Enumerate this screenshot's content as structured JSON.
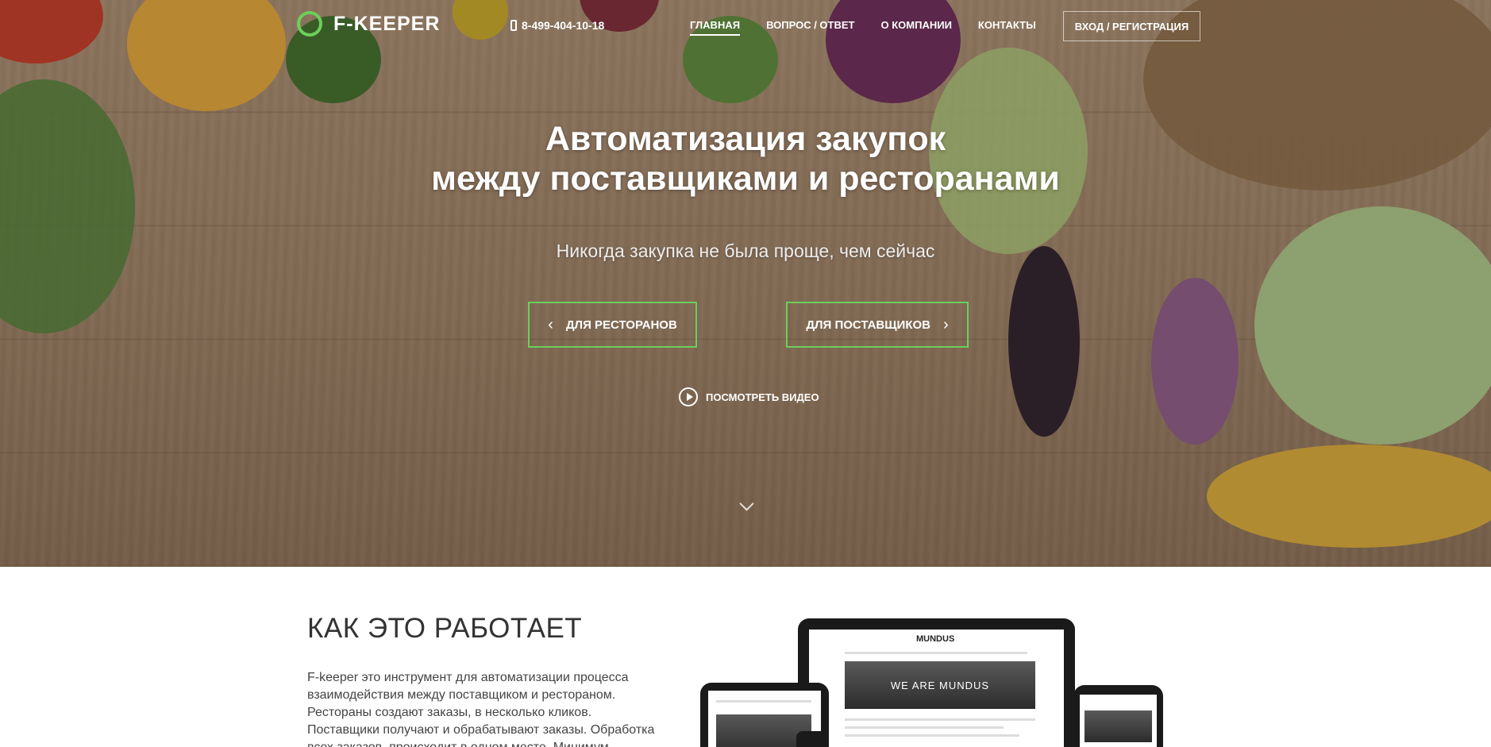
{
  "header": {
    "logo_text": "F-KEEPER",
    "phone": "8-499-404-10-18",
    "nav": [
      {
        "label": "ГЛАВНАЯ",
        "active": true
      },
      {
        "label": "ВОПРОС / ОТВЕТ",
        "active": false
      },
      {
        "label": "О КОМПАНИИ",
        "active": false
      },
      {
        "label": "КОНТАКТЫ",
        "active": false
      }
    ],
    "login_label": "ВХОД / РЕГИСТРАЦИЯ"
  },
  "hero": {
    "title_line1": "Автоматизация закупок",
    "title_line2": "между поставщиками и ресторанами",
    "subtitle": "Никогда закупка не была проще, чем сейчас",
    "btn_restaurants": "ДЛЯ РЕСТОРАНОВ",
    "btn_suppliers": "ДЛЯ ПОСТАВЩИКОВ",
    "video_label": "ПОСМОТРЕТЬ ВИДЕО"
  },
  "how": {
    "title": "КАК ЭТО РАБОТАЕТ",
    "text": "F-keeper это инструмент для автоматизации процесса взаимодействия между поставщиком и рестораном. Рестораны создают заказы, в несколько кликов. Поставщики получают и обрабатывают заказы. Обработка всех заказов, происходит в одном месте. Минимум"
  },
  "mockup": {
    "brand": "MUNDUS",
    "banner": "WE ARE MUNDUS"
  },
  "colors": {
    "accent": "#6ccf5a",
    "text": "#333333"
  }
}
